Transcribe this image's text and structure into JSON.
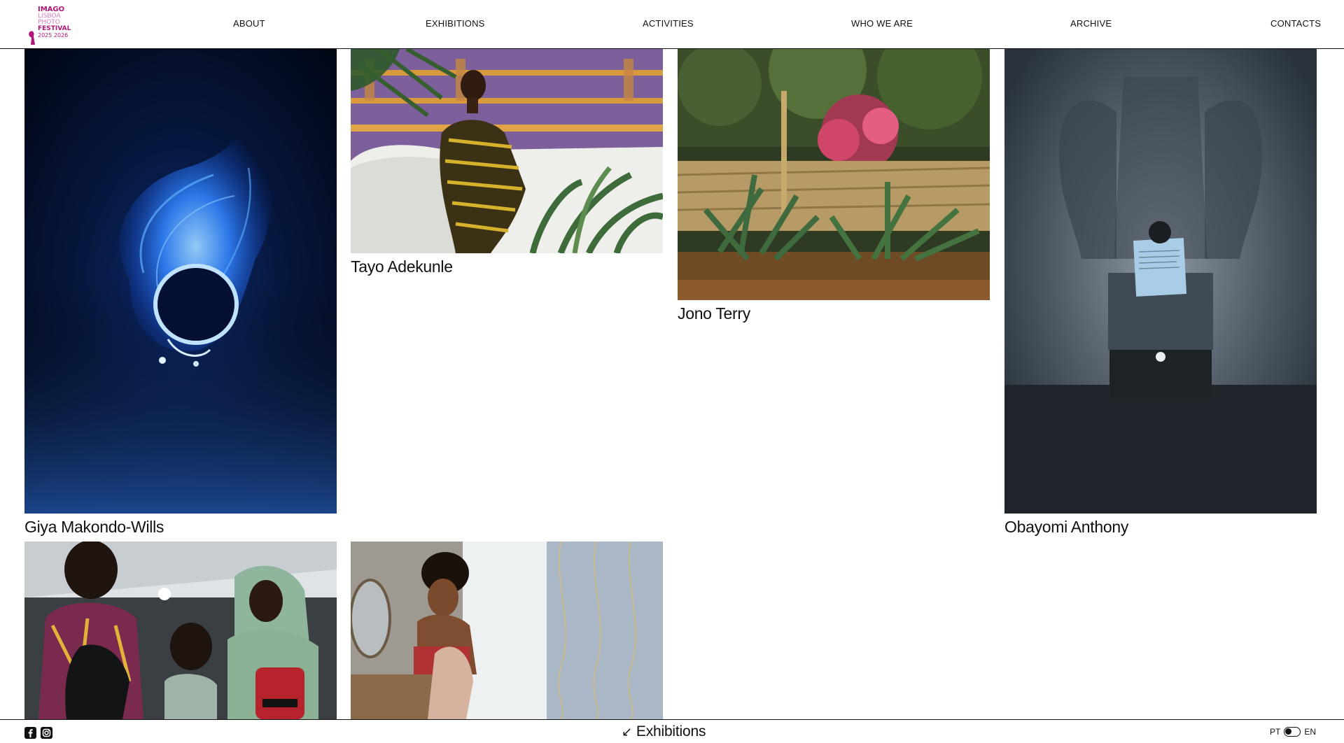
{
  "header": {
    "logo_text": [
      "IMAGO",
      "LISBOA",
      "PHOTO",
      "FESTIVAL",
      "2025",
      "2026"
    ],
    "nav": [
      {
        "label": "ABOUT"
      },
      {
        "label": "EXHIBITIONS"
      },
      {
        "label": "ACTIVITIES"
      },
      {
        "label": "WHO WE ARE"
      },
      {
        "label": "ARCHIVE"
      },
      {
        "label": "CONTACTS"
      }
    ]
  },
  "artists": [
    {
      "name": "Giya Makondo-Wills"
    },
    {
      "name": "Tayo Adekunle"
    },
    {
      "name": "Jono Terry"
    },
    {
      "name": "Obayomi Anthony"
    },
    {
      "name": ""
    },
    {
      "name": ""
    }
  ],
  "footer": {
    "section_arrow": "↙",
    "section_label": "Exhibitions",
    "lang_pt": "PT",
    "lang_en": "EN",
    "social": [
      "facebook-icon",
      "instagram-icon"
    ]
  },
  "colors": {
    "brand_magenta": "#b0157a",
    "ink": "#111111",
    "background": "#ffffff"
  }
}
